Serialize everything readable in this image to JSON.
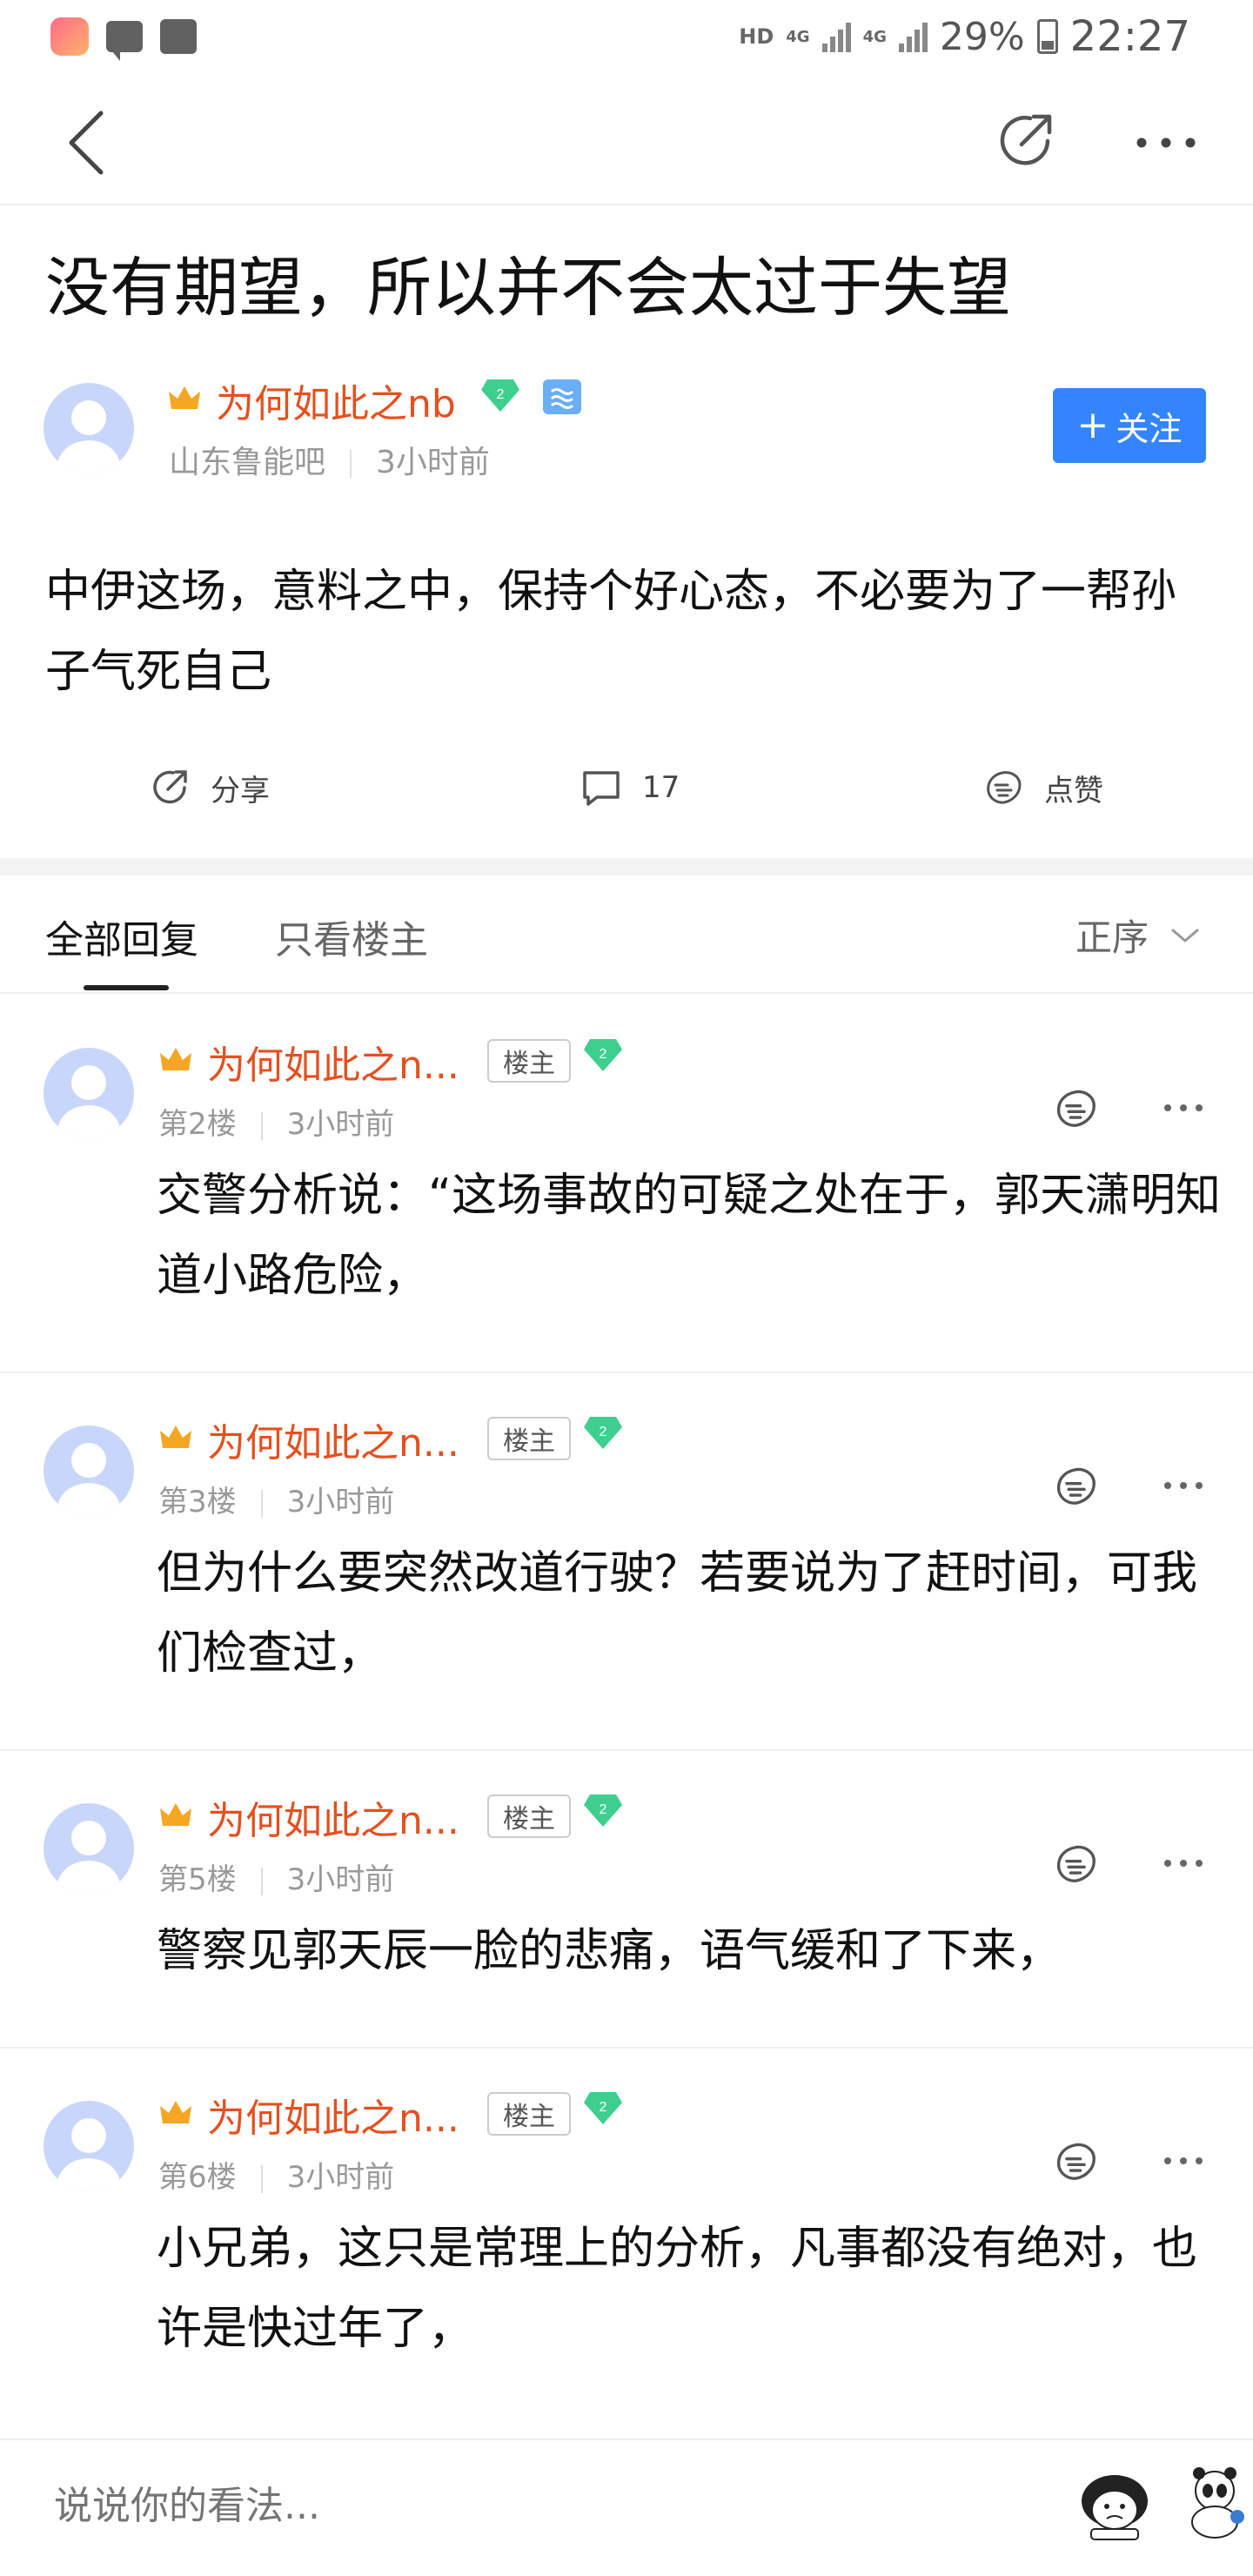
{
  "status_bar": {
    "hd": "HD",
    "net1": "4G",
    "net2": "4G",
    "battery": "29%",
    "time": "22:27"
  },
  "post": {
    "title": "没有期望，所以并不会太过于失望",
    "author": {
      "name": "为何如此之nb",
      "level": "2",
      "forum": "山东鲁能吧",
      "time": "3小时前"
    },
    "follow_label": "关注",
    "follow_plus": "+",
    "body": "中伊这场，意料之中，保持个好心态，不必要为了一帮孙子气死自己",
    "actions": {
      "share_label": "分享",
      "comment_count": "17",
      "like_label": "点赞"
    }
  },
  "tabs": {
    "all": "全部回复",
    "op_only": "只看楼主",
    "sort": "正序"
  },
  "replies": [
    {
      "name": "为何如此之n...",
      "tag": "楼主",
      "level": "2",
      "floor": "第2楼",
      "time": "3小时前",
      "text": "交警分析说：“这场事故的可疑之处在于，郭天潇明知道小路危险，"
    },
    {
      "name": "为何如此之n...",
      "tag": "楼主",
      "level": "2",
      "floor": "第3楼",
      "time": "3小时前",
      "text": "但为什么要突然改道行驶？若要说为了赶时间，可我们检查过，"
    },
    {
      "name": "为何如此之n...",
      "tag": "楼主",
      "level": "2",
      "floor": "第5楼",
      "time": "3小时前",
      "text": "警察见郭天辰一脸的悲痛，语气缓和了下来，"
    },
    {
      "name": "为何如此之n...",
      "tag": "楼主",
      "level": "2",
      "floor": "第6楼",
      "time": "3小时前",
      "text": "小兄弟，这只是常理上的分析，凡事都没有绝对，也许是快过年了，"
    }
  ],
  "comment_box": {
    "placeholder": "说说你的看法..."
  },
  "icons": {
    "back": "back-arrow-icon",
    "share": "share-icon",
    "more": "more-dots-icon",
    "comment": "comment-bubble-icon",
    "like": "like-hand-icon",
    "crown": "crown-icon",
    "level": "level-diamond-icon",
    "sort": "chevron-down-icon"
  },
  "colors": {
    "accent": "#3385ff",
    "username": "#e4501f",
    "crown": "#f5a623",
    "level": "#3ecf8e"
  }
}
